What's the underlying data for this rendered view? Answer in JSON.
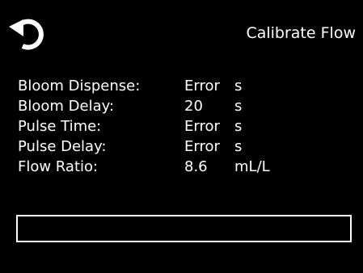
{
  "header": {
    "title": "Calibrate Flow",
    "back_icon": "refresh-back-icon"
  },
  "params": [
    {
      "label": "Bloom Dispense:",
      "value": "Error",
      "unit": "s"
    },
    {
      "label": "Bloom Delay:",
      "value": "20",
      "unit": "s"
    },
    {
      "label": "Pulse Time:",
      "value": "Error",
      "unit": "s"
    },
    {
      "label": "Pulse Delay:",
      "value": "Error",
      "unit": "s"
    },
    {
      "label": "Flow Ratio:",
      "value": "8.6",
      "unit": "mL/L"
    }
  ],
  "status_box": {
    "text": ""
  },
  "colors": {
    "background": "#000000",
    "foreground": "#ffffff"
  }
}
